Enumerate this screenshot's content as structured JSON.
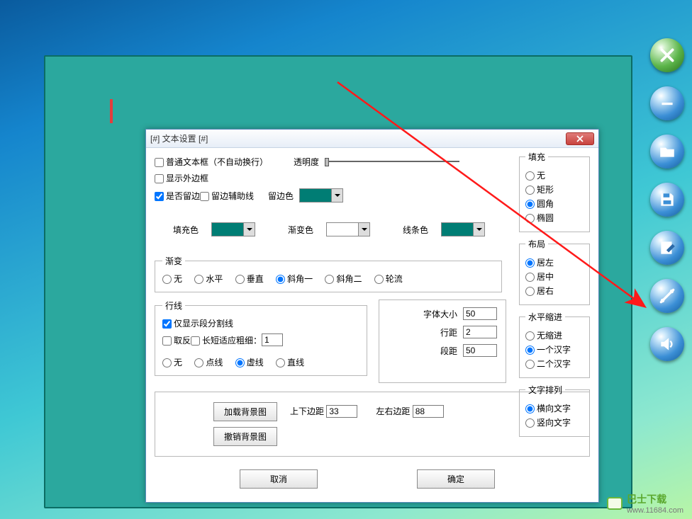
{
  "dialog": {
    "title": "[#] 文本设置 [#]",
    "checkboxes": {
      "plain_textbox": "普通文本框（不自动换行）",
      "show_outer_border": "显示外边框",
      "has_margin": "是否留边",
      "margin_guides": "留边辅助线"
    },
    "opacity_label": "透明度",
    "margin_color_label": "留边色",
    "fill_color_label": "填充色",
    "gradient_color_label": "渐变色",
    "line_color_label": "线条色",
    "colors": {
      "margin": "#007d74",
      "fill": "#007d74",
      "gradient": "#ffffff",
      "line": "#007d74"
    },
    "gradient_group": {
      "legend": "渐变",
      "options": [
        "无",
        "水平",
        "垂直",
        "斜角一",
        "斜角二",
        "轮流"
      ],
      "selected": "斜角一"
    },
    "lines_group": {
      "legend": "行线",
      "only_segment": "仅显示段分割线",
      "invert": "取反",
      "auto_length": "长短适应",
      "thickness_label": "粗细：",
      "thickness_value": "1",
      "styles": [
        "无",
        "点线",
        "虚线",
        "直线"
      ],
      "style_selected": "虚线"
    },
    "font_block": {
      "font_size_label": "字体大小",
      "font_size_value": "50",
      "line_spacing_label": "行距",
      "line_spacing_value": "2",
      "para_spacing_label": "段距",
      "para_spacing_value": "50"
    },
    "bg_block": {
      "load_bg": "加载背景图",
      "clear_bg": "撤销背景图",
      "vmargin_label": "上下边距",
      "vmargin_value": "33",
      "hmargin_label": "左右边距",
      "hmargin_value": "88"
    },
    "fill_shape": {
      "legend": "填充",
      "options": [
        "无",
        "矩形",
        "圆角",
        "椭圆"
      ],
      "selected": "圆角"
    },
    "layout": {
      "legend": "布局",
      "options": [
        "居左",
        "居中",
        "居右"
      ],
      "selected": "居左"
    },
    "indent": {
      "legend": "水平缩进",
      "options": [
        "无缩进",
        "一个汉字",
        "二个汉字"
      ],
      "selected": "一个汉字"
    },
    "text_dir": {
      "legend": "文字排列",
      "options": [
        "横向文字",
        "竖向文字"
      ],
      "selected": "横向文字"
    },
    "buttons": {
      "cancel": "取消",
      "ok": "确定"
    }
  },
  "sidebar_icons": [
    "close-icon",
    "minimize-icon",
    "folder-icon",
    "save-icon",
    "edit-icon",
    "tools-icon",
    "sound-icon"
  ],
  "badge": {
    "name": "巴士下载",
    "url": "www.11684.com"
  }
}
